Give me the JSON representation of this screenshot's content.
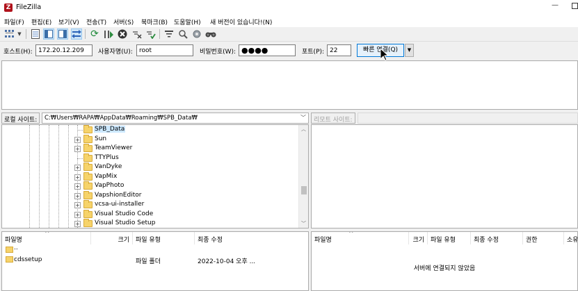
{
  "window": {
    "title": "FileZilla",
    "app_icon": "filezilla-logo-icon",
    "controls": [
      "minimize-icon",
      "maximize-icon"
    ]
  },
  "menu": [
    "파일(F)",
    "편집(E)",
    "보기(V)",
    "전송(T)",
    "서버(S)",
    "북마크(B)",
    "도움말(H)",
    "새 버전이 있습니다!(N)"
  ],
  "toolbar": {
    "icons": [
      "site-manager-icon",
      "site-manager-dropdown-icon",
      "toggle-message-log-icon",
      "toggle-local-tree-icon",
      "toggle-remote-tree-icon",
      "toggle-transfer-queue-icon",
      "refresh-icon",
      "process-queue-icon",
      "cancel-operation-icon",
      "disconnect-icon",
      "reconnect-icon",
      "directory-filter-icon",
      "dir-compare-icon",
      "sync-browsing-icon",
      "search-remote-files-icon"
    ]
  },
  "quickconnect": {
    "host_label": "호스트(H):",
    "host_value": "172.20.12.209",
    "user_label": "사용자명(U):",
    "user_value": "root",
    "password_label": "비밀번호(W):",
    "password_value": "●●●●",
    "port_label": "포트(P):",
    "port_value": "22",
    "connect_button": "빠른 연결(Q)",
    "dropdown_icon": "dropdown-arrow-icon"
  },
  "local_site": {
    "label": "로컬 사이트:",
    "path": "C:₩Users₩RAPA₩AppData₩Roaming₩SPB_Data₩",
    "tree_items": [
      {
        "label": "SPB_Data",
        "expander": "",
        "selected": true
      },
      {
        "label": "Sun",
        "expander": "+"
      },
      {
        "label": "TeamViewer",
        "expander": "+"
      },
      {
        "label": "TTYPlus",
        "expander": ""
      },
      {
        "label": "VanDyke",
        "expander": "+"
      },
      {
        "label": "VapMix",
        "expander": "+"
      },
      {
        "label": "VapPhoto",
        "expander": "+"
      },
      {
        "label": "VapshionEditor",
        "expander": "+"
      },
      {
        "label": "vcsa-ui-installer",
        "expander": "+"
      },
      {
        "label": "Visual Studio Code",
        "expander": "+"
      },
      {
        "label": "Visual Studio Setup",
        "expander": "+"
      }
    ]
  },
  "remote_site": {
    "label": "리모트 사이트:",
    "path": ""
  },
  "local_files": {
    "columns": [
      "파일명",
      "크기",
      "파일 유형",
      "최종 수정"
    ],
    "rows": [
      {
        "name": "..",
        "size": "",
        "type": "",
        "modified": ""
      },
      {
        "name": "cdssetup",
        "size": "",
        "type": "파일 폴더",
        "modified": "2022-10-04 오후 ..."
      }
    ]
  },
  "remote_files": {
    "columns": [
      "파일명",
      "크기",
      "파일 유형",
      "최종 수정",
      "권한",
      "소유"
    ],
    "empty_message": "서버에 연결되지 않았음"
  },
  "colors": {
    "window_bg": "#f0f0f0",
    "pane_bg": "#ffffff",
    "selection": "#cce8ff",
    "accent_button_border": "#0078d7",
    "folder_yellow": "#f6d36a"
  }
}
